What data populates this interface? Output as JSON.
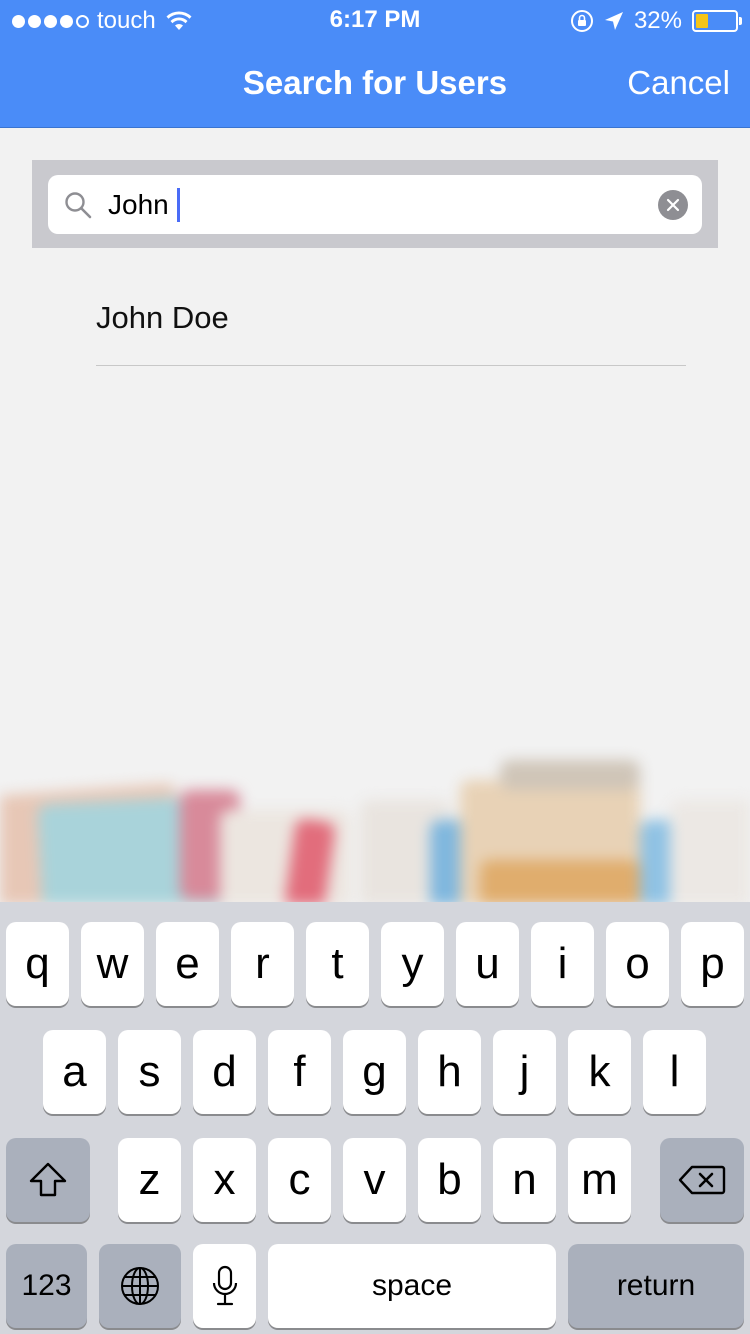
{
  "status_bar": {
    "carrier": "touch",
    "time": "6:17 PM",
    "battery_percent": "32%",
    "battery_level": 0.32,
    "battery_color": "#f5c518"
  },
  "nav": {
    "title": "Search for Users",
    "cancel_label": "Cancel",
    "bar_color": "#4a8cf8"
  },
  "search": {
    "query": "John",
    "icon": "search-icon",
    "clear_icon": "clear-icon"
  },
  "results": [
    {
      "name": "John Doe"
    }
  ],
  "keyboard": {
    "row1": [
      "q",
      "w",
      "e",
      "r",
      "t",
      "y",
      "u",
      "i",
      "o",
      "p"
    ],
    "row2": [
      "a",
      "s",
      "d",
      "f",
      "g",
      "h",
      "j",
      "k",
      "l"
    ],
    "row3": [
      "z",
      "x",
      "c",
      "v",
      "b",
      "n",
      "m"
    ],
    "numbers_label": "123",
    "space_label": "space",
    "return_label": "return",
    "shift_icon": "shift-icon",
    "delete_icon": "backspace-icon",
    "globe_icon": "globe-icon",
    "mic_icon": "microphone-icon"
  }
}
